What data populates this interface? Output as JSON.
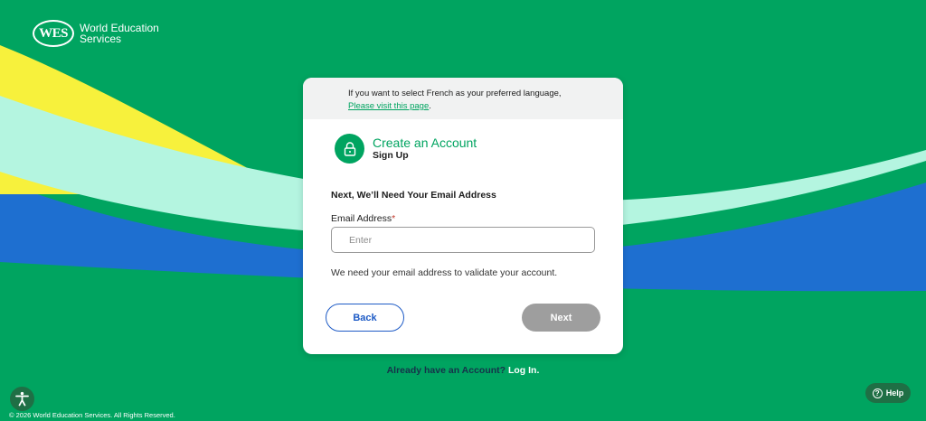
{
  "brand": {
    "logo_mark": "WES",
    "name": "World Education Services"
  },
  "language_banner": {
    "text": "If you want to select French as your preferred language,",
    "link": "Please visit this page",
    "period": "."
  },
  "card": {
    "icon": "lock-icon",
    "title": "Create an Account",
    "subtitle": "Sign Up",
    "step_title": "Next, We’ll Need Your Email Address",
    "email": {
      "label": "Email Address",
      "required_mark": "*",
      "placeholder": "Enter",
      "value": ""
    },
    "helper_text": "We need your email address to validate your account.",
    "back_label": "Back",
    "next_label": "Next"
  },
  "login": {
    "question": "Already have an Account?",
    "link": "Log In."
  },
  "footer": {
    "copyright": "© 2026 World Education Services. All Rights Reserved."
  },
  "help": {
    "label": "Help",
    "icon": "question-circle-icon"
  },
  "accessibility": {
    "icon": "accessibility-icon"
  },
  "colors": {
    "background": "#00a460",
    "wave_yellow": "#f7f13c",
    "wave_mint": "#b4f5e0",
    "wave_blue": "#1e6fd0",
    "primary_green": "#00a460",
    "back_button_blue": "#1e5bc6",
    "next_button_disabled": "#9e9e9e"
  }
}
